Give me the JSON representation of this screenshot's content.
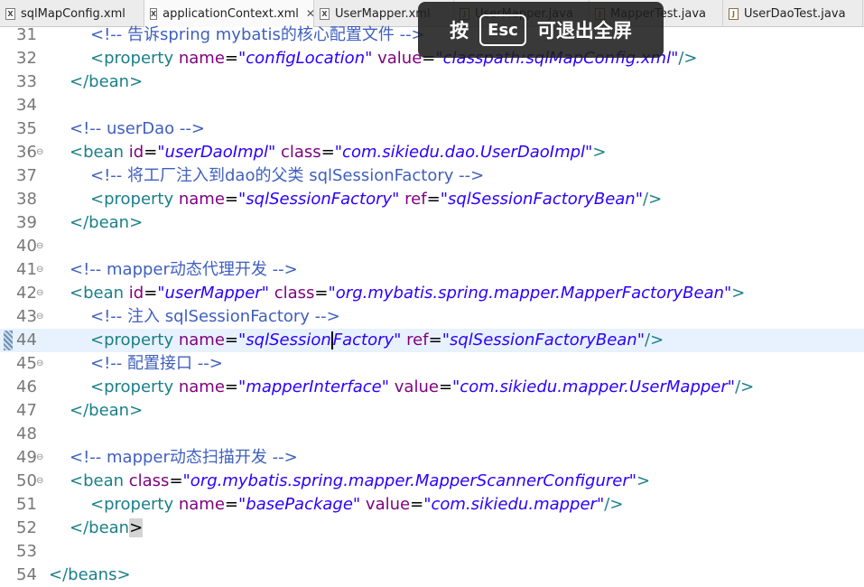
{
  "tabs": [
    {
      "label": "sqlMapConfig.xml",
      "icon": "xml-file-icon",
      "active": false
    },
    {
      "label": "applicationContext.xml",
      "icon": "xml-file-icon",
      "active": true
    },
    {
      "label": "UserMapper.xml",
      "icon": "xml-file-icon",
      "active": false
    },
    {
      "label": "UserMapper.java",
      "icon": "java-file-icon",
      "active": false
    },
    {
      "label": "MapperTest.java",
      "icon": "java-file-icon",
      "active": false
    },
    {
      "label": "UserDaoTest.java",
      "icon": "java-file-icon",
      "active": false
    }
  ],
  "overlay": {
    "prefix": "按",
    "key": "Esc",
    "suffix": "可退出全屏"
  },
  "lines": [
    {
      "n": "31",
      "indent": 2,
      "tokens": [
        {
          "k": "c",
          "s": "<!-- 告诉spring mybatis的核心配置文件 -->"
        }
      ]
    },
    {
      "n": "32",
      "indent": 2,
      "tokens": [
        {
          "k": "t",
          "s": "<property "
        },
        {
          "k": "a",
          "s": "name"
        },
        {
          "k": "txt",
          "s": "="
        },
        {
          "k": "v",
          "s": "\"configLocation\""
        },
        {
          "k": "a",
          "s": " value"
        },
        {
          "k": "txt",
          "s": "="
        },
        {
          "k": "v",
          "s": "\"classpath:sqlMapConfig.xml\""
        },
        {
          "k": "t",
          "s": "/>"
        }
      ]
    },
    {
      "n": "33",
      "indent": 1,
      "tokens": [
        {
          "k": "t",
          "s": "</bean>"
        }
      ]
    },
    {
      "n": "34",
      "indent": 0,
      "tokens": []
    },
    {
      "n": "35",
      "indent": 1,
      "tokens": [
        {
          "k": "c",
          "s": "<!-- userDao -->"
        }
      ]
    },
    {
      "n": "36",
      "indent": 1,
      "fold": true,
      "tokens": [
        {
          "k": "t",
          "s": "<bean "
        },
        {
          "k": "a",
          "s": "id"
        },
        {
          "k": "txt",
          "s": "="
        },
        {
          "k": "v",
          "s": "\"userDaoImpl\""
        },
        {
          "k": "a",
          "s": " class"
        },
        {
          "k": "txt",
          "s": "="
        },
        {
          "k": "v",
          "s": "\"com.sikiedu.dao.UserDaoImpl\""
        },
        {
          "k": "t",
          "s": ">"
        }
      ]
    },
    {
      "n": "37",
      "indent": 2,
      "tokens": [
        {
          "k": "c",
          "s": "<!-- 将工厂注入到dao的父类 sqlSessionFactory -->"
        }
      ]
    },
    {
      "n": "38",
      "indent": 2,
      "tokens": [
        {
          "k": "t",
          "s": "<property "
        },
        {
          "k": "a",
          "s": "name"
        },
        {
          "k": "txt",
          "s": "="
        },
        {
          "k": "v",
          "s": "\"sqlSessionFactory\""
        },
        {
          "k": "a",
          "s": " ref"
        },
        {
          "k": "txt",
          "s": "="
        },
        {
          "k": "v",
          "s": "\"sqlSessionFactoryBean\""
        },
        {
          "k": "t",
          "s": "/>"
        }
      ]
    },
    {
      "n": "39",
      "indent": 1,
      "tokens": [
        {
          "k": "t",
          "s": "</bean>"
        }
      ]
    },
    {
      "n": "40",
      "indent": 0,
      "fold": true,
      "tokens": []
    },
    {
      "n": "41",
      "indent": 1,
      "fold": true,
      "tokens": [
        {
          "k": "c",
          "s": "<!-- mapper动态代理开发 -->"
        }
      ]
    },
    {
      "n": "42",
      "indent": 1,
      "fold": true,
      "tokens": [
        {
          "k": "t",
          "s": "<bean "
        },
        {
          "k": "a",
          "s": "id"
        },
        {
          "k": "txt",
          "s": "="
        },
        {
          "k": "v",
          "s": "\"userMapper\""
        },
        {
          "k": "a",
          "s": " class"
        },
        {
          "k": "txt",
          "s": "="
        },
        {
          "k": "v",
          "s": "\"org.mybatis.spring.mapper.MapperFactoryBean\""
        },
        {
          "k": "t",
          "s": ">"
        }
      ]
    },
    {
      "n": "43",
      "indent": 2,
      "fold": true,
      "tokens": [
        {
          "k": "c",
          "s": "<!-- 注入 sqlSessionFactory -->"
        }
      ]
    },
    {
      "n": "44",
      "indent": 2,
      "current": true,
      "tokens": [
        {
          "k": "t",
          "s": "<property "
        },
        {
          "k": "a",
          "s": "name"
        },
        {
          "k": "txt",
          "s": "="
        },
        {
          "k": "v",
          "s": "\"sqlSession"
        },
        {
          "k": "cursor",
          "s": ""
        },
        {
          "k": "v",
          "s": "Factory\""
        },
        {
          "k": "a",
          "s": " ref"
        },
        {
          "k": "txt",
          "s": "="
        },
        {
          "k": "v",
          "s": "\"sqlSessionFactoryBean\""
        },
        {
          "k": "t",
          "s": "/>"
        }
      ]
    },
    {
      "n": "45",
      "indent": 2,
      "fold": true,
      "tokens": [
        {
          "k": "c",
          "s": "<!-- 配置接口 -->"
        }
      ]
    },
    {
      "n": "46",
      "indent": 2,
      "tokens": [
        {
          "k": "t",
          "s": "<property "
        },
        {
          "k": "a",
          "s": "name"
        },
        {
          "k": "txt",
          "s": "="
        },
        {
          "k": "v",
          "s": "\"mapperInterface\""
        },
        {
          "k": "a",
          "s": " value"
        },
        {
          "k": "txt",
          "s": "="
        },
        {
          "k": "v",
          "s": "\"com.sikiedu.mapper.UserMapper\""
        },
        {
          "k": "t",
          "s": "/>"
        }
      ]
    },
    {
      "n": "47",
      "indent": 1,
      "tokens": [
        {
          "k": "t",
          "s": "</bean>"
        }
      ]
    },
    {
      "n": "48",
      "indent": 0,
      "tokens": []
    },
    {
      "n": "49",
      "indent": 1,
      "fold": true,
      "tokens": [
        {
          "k": "c",
          "s": "<!-- mapper动态扫描开发 -->"
        }
      ]
    },
    {
      "n": "50",
      "indent": 1,
      "fold": true,
      "tokens": [
        {
          "k": "t",
          "s": "<bean "
        },
        {
          "k": "a",
          "s": "class"
        },
        {
          "k": "txt",
          "s": "="
        },
        {
          "k": "v",
          "s": "\"org.mybatis.spring.mapper.MapperScannerConfigurer\""
        },
        {
          "k": "t",
          "s": ">"
        }
      ]
    },
    {
      "n": "51",
      "indent": 2,
      "tokens": [
        {
          "k": "t",
          "s": "<property "
        },
        {
          "k": "a",
          "s": "name"
        },
        {
          "k": "txt",
          "s": "="
        },
        {
          "k": "v",
          "s": "\"basePackage\""
        },
        {
          "k": "a",
          "s": " value"
        },
        {
          "k": "txt",
          "s": "="
        },
        {
          "k": "v",
          "s": "\"com.sikiedu.mapper\""
        },
        {
          "k": "t",
          "s": "/>"
        }
      ]
    },
    {
      "n": "52",
      "indent": 1,
      "tokens": [
        {
          "k": "t",
          "s": "</bean"
        },
        {
          "k": "hl",
          "s": ">"
        }
      ]
    },
    {
      "n": "53",
      "indent": 0,
      "tokens": []
    },
    {
      "n": "54",
      "indent": 0,
      "tokens": [
        {
          "k": "t",
          "s": "</beans>"
        }
      ]
    }
  ],
  "colors": {
    "tag": "#1a7f87",
    "attr": "#7f007f",
    "value": "#2a00ff",
    "comment": "#3f5fbf",
    "current_line": "#e8f2fe"
  }
}
